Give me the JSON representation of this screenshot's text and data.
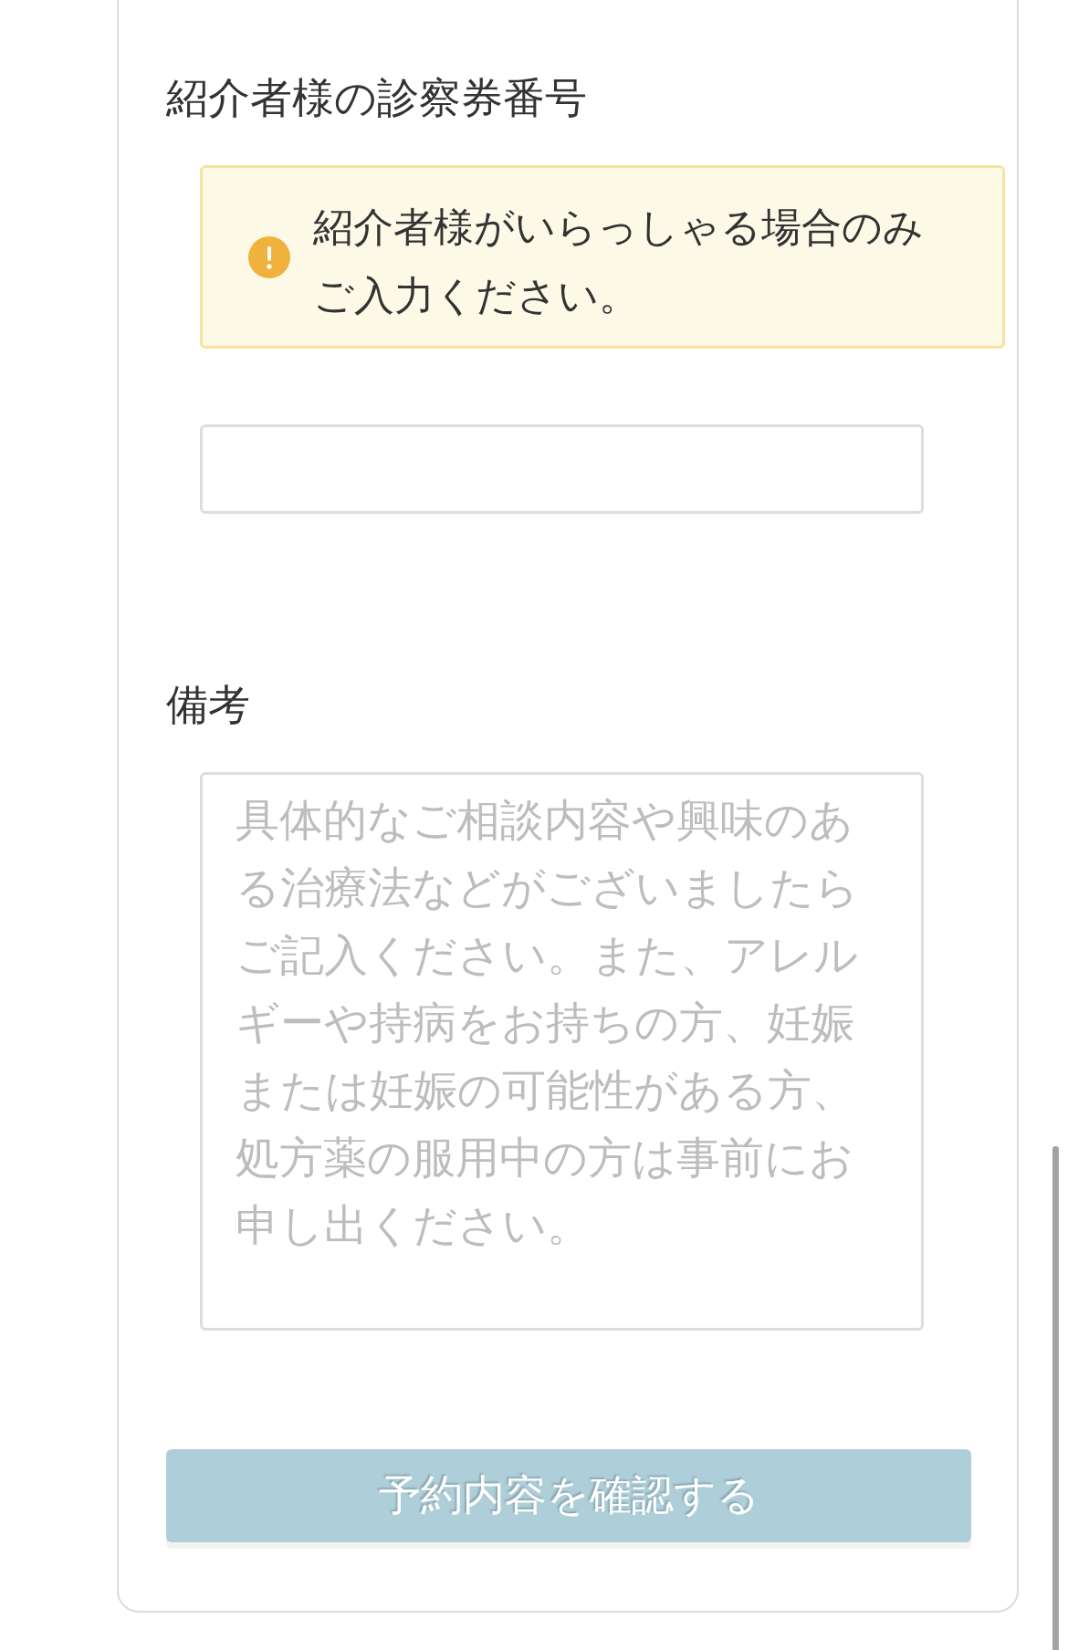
{
  "referrer_section": {
    "heading": "紹介者様の診察券番号",
    "notice": {
      "kind": "warning",
      "text": "紹介者様がいらっしゃる場合のみご入力ください。"
    },
    "input": {
      "kind": "text"
    }
  },
  "remarks_section": {
    "heading": "備考",
    "input": {
      "kind": "textarea",
      "placeholder": "具体的なご相談内容や興味のある治療法などがございましたらご記入ください。また、アレルギーや持病をお持ちの方、妊娠または妊娠の可能性がある方、処方薬の服用中の方は事前にお申し出ください。"
    }
  },
  "submit_button": {
    "label": "予約内容を確認する",
    "disabled": true
  }
}
